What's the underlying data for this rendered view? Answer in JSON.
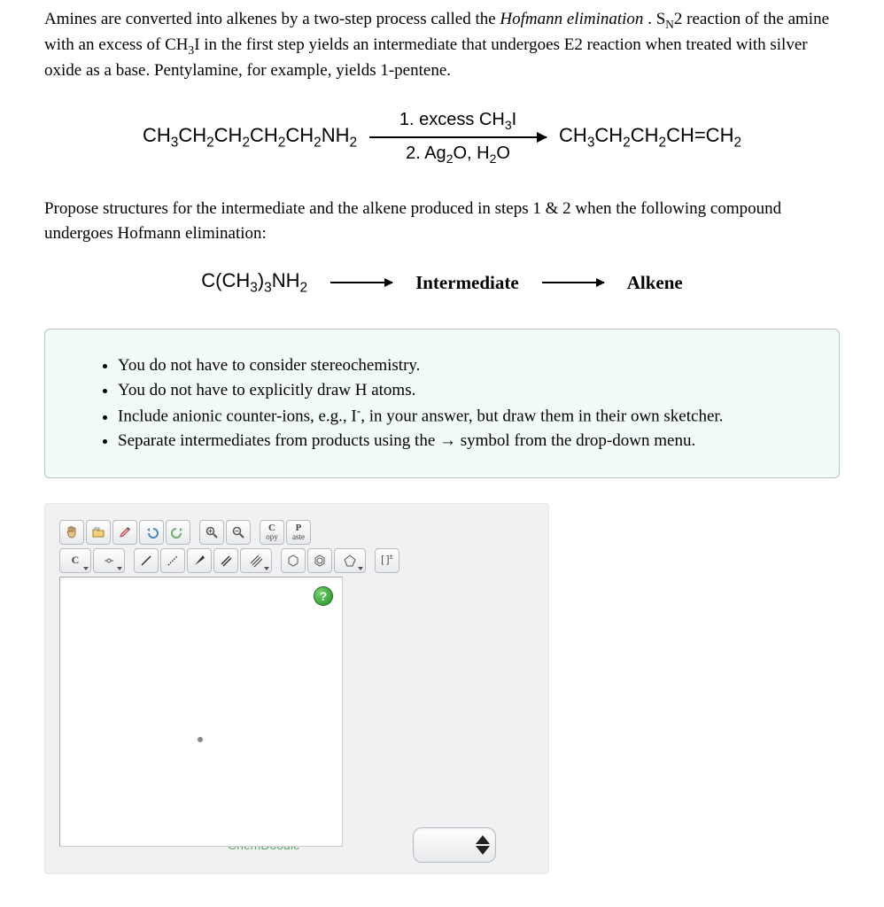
{
  "intro": {
    "p1_a": "Amines are converted into alkenes by a two-step process called the ",
    "p1_italic": "Hofmann elimination",
    "p1_b": ". S",
    "p1_sub1": "N",
    "p1_c": "2 reaction of the amine with an excess of CH",
    "p1_sub2": "3",
    "p1_d": "I in the first step yields an intermediate that undergoes E2 reaction when treated with silver oxide as a base. Pentylamine, for example, yields 1-pentene."
  },
  "reaction": {
    "start": {
      "pre": "CH",
      "s1": "3",
      "mid1": "CH",
      "s2": "2",
      "mid2": "CH",
      "s3": "2",
      "mid3": "CH",
      "s4": "2",
      "mid4": "CH",
      "s5": "2",
      "mid5": "NH",
      "s6": "2"
    },
    "cond1": {
      "pre": "1. excess CH",
      "s1": "3",
      "post": "I"
    },
    "cond2": {
      "pre": "2. Ag",
      "s1": "2",
      "mid": "O, H",
      "s2": "2",
      "post": "O"
    },
    "prod": {
      "pre": "CH",
      "s1": "3",
      "mid1": "CH",
      "s2": "2",
      "mid2": "CH",
      "s3": "2",
      "mid3": "CH=CH",
      "s4": "2"
    }
  },
  "question": "Propose structures for the intermediate and the alkene produced in steps 1 & 2 when the following compound undergoes Hofmann elimination:",
  "scheme2": {
    "start": {
      "pre": "C(CH",
      "s1": "3",
      "mid": ")",
      "s2": "3",
      "mid2": "NH",
      "s3": "2"
    },
    "label1": "Intermediate",
    "label2": "Alkene"
  },
  "hints": {
    "h1": "You do not have to consider stereochemistry.",
    "h2": "You do not have to explicitly draw H atoms.",
    "h3_a": "Include anionic counter-ions, e.g., I",
    "h3_sup": "-",
    "h3_b": ", in your answer, but draw them in their own sketcher.",
    "h4": "Separate intermediates from products using the → symbol from the drop-down menu."
  },
  "sketcher": {
    "copy_top": "C",
    "copy_bot": "opy",
    "paste_top": "P",
    "paste_bot": "aste",
    "element": "C",
    "charge": "[ ]",
    "charge_sup": "±",
    "help": "?",
    "brand": "ChemDoodle",
    "brand_sup": "®"
  }
}
